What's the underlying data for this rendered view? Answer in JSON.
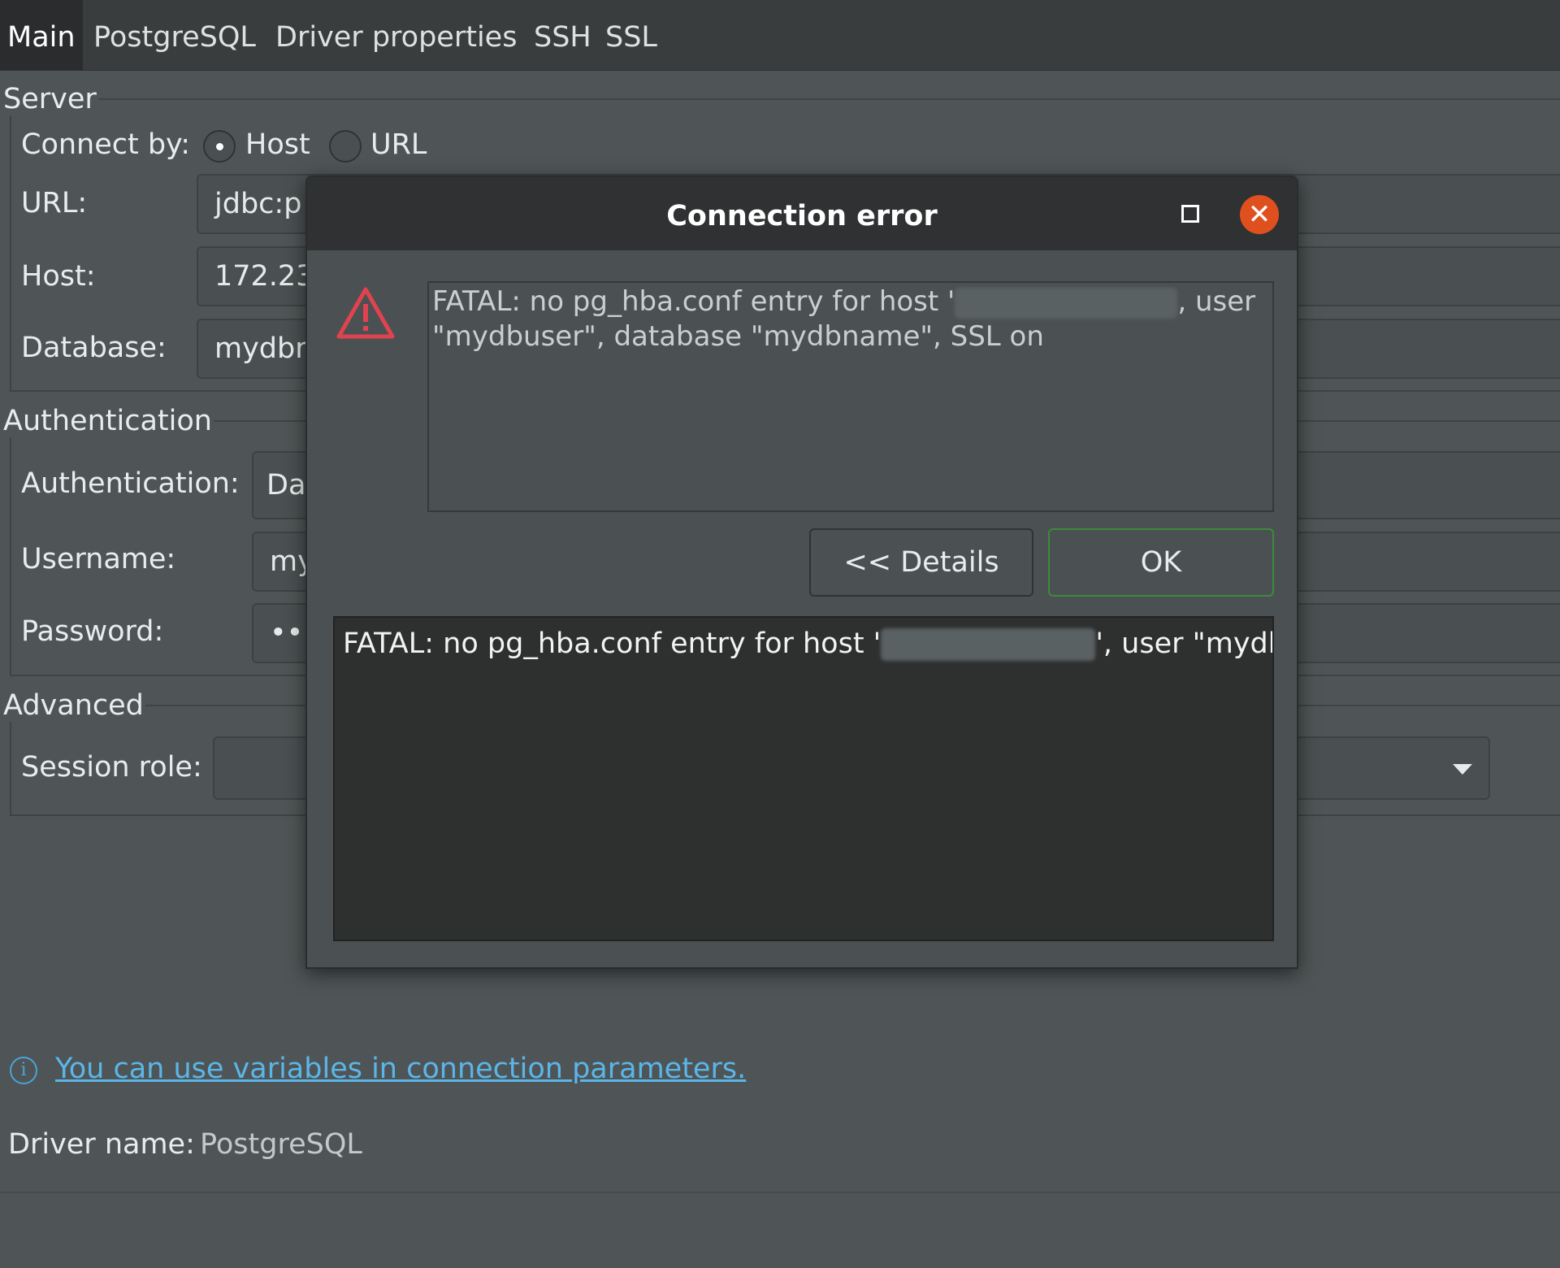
{
  "tabs": [
    {
      "label": "Main",
      "active": true
    },
    {
      "label": "PostgreSQL"
    },
    {
      "label": "Driver properties"
    },
    {
      "label": "SSH"
    },
    {
      "label": "SSL"
    }
  ],
  "server": {
    "legend": "Server",
    "connect_by_label": "Connect by:",
    "option_host": "Host",
    "option_url": "URL",
    "selected": "Host",
    "url_label": "URL:",
    "url_value": "jdbc:p",
    "host_label": "Host:",
    "host_value": "172.23",
    "database_label": "Database:",
    "database_value": "mydbn"
  },
  "auth": {
    "legend": "Authentication",
    "auth_label": "Authentication:",
    "auth_value": "Da",
    "username_label": "Username:",
    "username_value": "my",
    "password_label": "Password:",
    "password_value": "•••"
  },
  "advanced": {
    "legend": "Advanced",
    "session_role_label": "Session role:",
    "session_role_value": ""
  },
  "info_link": "You can use variables in connection parameters.",
  "driver": {
    "label": "Driver name:",
    "value": "PostgreSQL"
  },
  "dialog": {
    "title": "Connection error",
    "message_part1": "FATAL: no pg_hba.conf entry for host '",
    "message_part2": ", user \"mydbuser\", database \"mydbname\", SSL on",
    "details_button": "<< Details",
    "ok_button": "OK",
    "details_part1": "FATAL: no pg_hba.conf entry for host '",
    "details_part2": "', user \"mydbu"
  },
  "icons": {
    "warning": "warning-triangle-icon",
    "close": "close-icon",
    "maximize": "maximize-icon",
    "info": "info-icon",
    "dropdown": "chevron-down-icon"
  },
  "colors": {
    "background": "#4f5556",
    "tabbar": "#3a3d3e",
    "link": "#5bb6e8",
    "close_button": "#e0501f",
    "warning": "#e0434f",
    "ok_border": "#3d8a3d"
  }
}
